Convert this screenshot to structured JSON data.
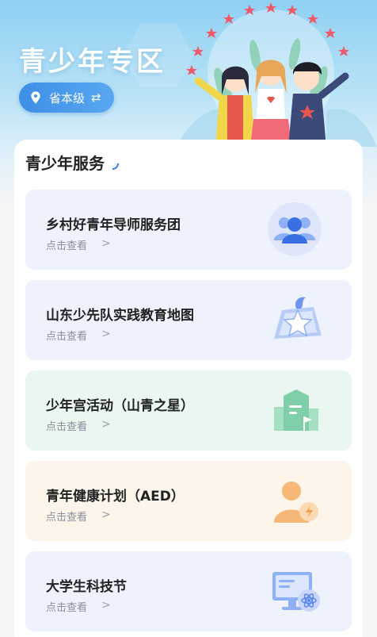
{
  "hero": {
    "title": "青少年专区",
    "region_label": "省本级",
    "region_swap_icon": "⇄"
  },
  "services_title": "青少年服务",
  "services": [
    {
      "name": "乡村好青年导师服务团",
      "sub": "点击查看",
      "chevron": ">",
      "icon": "group-icon",
      "bg": "#eef2fc"
    },
    {
      "name": "山东少先队实践教育地图",
      "sub": "点击查看",
      "chevron": ">",
      "icon": "map-star-icon",
      "bg": "#eef2fc"
    },
    {
      "name": "少年宫活动（山青之星）",
      "sub": "点击查看",
      "chevron": ">",
      "icon": "building-icon",
      "bg": "#eaf7f1"
    },
    {
      "name": "青年健康计划（AED）",
      "sub": "点击查看",
      "chevron": ">",
      "icon": "health-person-icon",
      "bg": "#fdf4ea"
    },
    {
      "name": "大学生科技节",
      "sub": "点击查看",
      "chevron": ">",
      "icon": "computer-atom-icon",
      "bg": "#eef2fc"
    }
  ],
  "colors": {
    "accent": "#3d8fe6",
    "hero_top": "#8fd0f3",
    "card_blue": "#eef2fc",
    "card_green": "#eaf7f1",
    "card_orange": "#fdf4ea"
  }
}
